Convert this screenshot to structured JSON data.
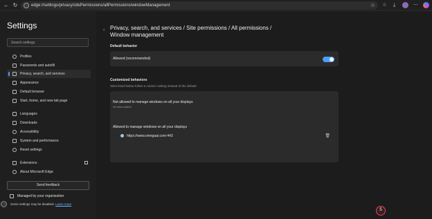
{
  "browser": {
    "url": "edge://settings/privacy/sitePermissions/allPermissions/windowManagement",
    "icons": [
      "back-icon",
      "refresh-icon",
      "edge-logo-icon",
      "star-icon",
      "favorites-icon",
      "downloads-icon",
      "extensions-icon",
      "profile-avatar",
      "menu-icon",
      "copilot-icon"
    ]
  },
  "sidebar": {
    "title": "Settings",
    "search_placeholder": "Search settings",
    "items": [
      {
        "label": "Profiles",
        "icon": "person-icon"
      },
      {
        "label": "Passwords and autofill",
        "icon": "key-icon"
      },
      {
        "label": "Privacy, search, and services",
        "icon": "lock-icon",
        "active": true
      },
      {
        "label": "Appearance",
        "icon": "brush-icon"
      },
      {
        "label": "Default browser",
        "icon": "browser-icon"
      },
      {
        "label": "Start, home, and new tab page",
        "icon": "home-icon"
      },
      {
        "label": "Languages",
        "icon": "language-icon"
      },
      {
        "label": "Downloads",
        "icon": "download-icon"
      },
      {
        "label": "Accessibility",
        "icon": "accessibility-icon"
      },
      {
        "label": "System and performance",
        "icon": "system-icon"
      },
      {
        "label": "Reset settings",
        "icon": "reset-icon"
      },
      {
        "label": "Extensions",
        "icon": "puzzle-icon"
      },
      {
        "label": "About Microsoft Edge",
        "icon": "edge-icon"
      }
    ],
    "feedback_label": "Send feedback",
    "managed_text": "Managed by your organization",
    "disabled_text": "Some settings may be disabled.",
    "learn_more": "Learn more"
  },
  "main": {
    "breadcrumb_line1": "Privacy, search, and services  /  Site permissions  /  All permissions  /",
    "breadcrumb_line2": "Window management",
    "default_behavior": {
      "heading": "Default behavior",
      "toggle_label": "Allowed (recommended)",
      "toggle_on": true
    },
    "customized": {
      "heading": "Customized behaviors",
      "subtext": "Sites listed below follow a custom setting instead of the default",
      "not_allowed_title": "Not allowed to manage windows on all your displays",
      "not_allowed_empty": "No sites added",
      "allowed_title": "Allowed to manage windows on all your displays",
      "allowed_sites": [
        "https://www.omegaai.com:443"
      ]
    }
  },
  "notification_badge": "5",
  "colors": {
    "accent": "#4c9dff",
    "badge_border": "#e0485a"
  }
}
